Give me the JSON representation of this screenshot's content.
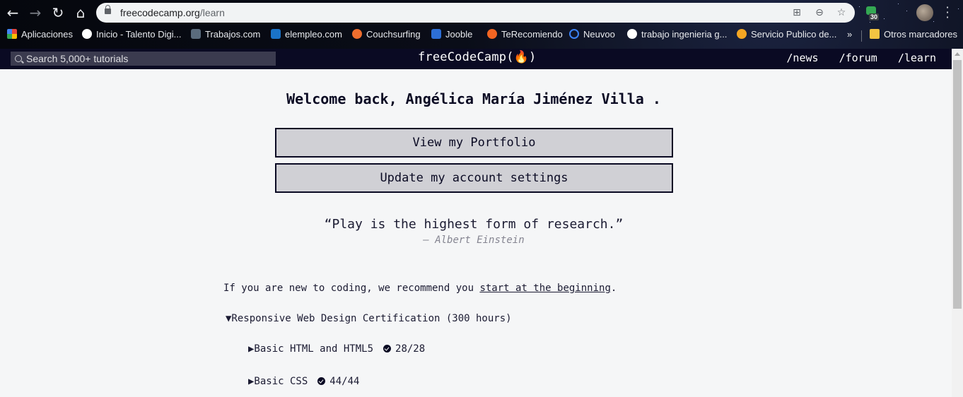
{
  "browser": {
    "url_host": "freecodecamp.org",
    "url_path": "/learn",
    "extension_badge": "30",
    "bookmarks": [
      {
        "label": "Aplicaciones",
        "color": "#e8453c"
      },
      {
        "label": "Inicio - Talento Digi...",
        "color": "#ffffff"
      },
      {
        "label": "Trabajos.com",
        "color": "#5a6b7d"
      },
      {
        "label": "elempleo.com",
        "color": "#1a73c8"
      },
      {
        "label": "Couchsurfing",
        "color": "#ee6e2e"
      },
      {
        "label": "Jooble",
        "color": "#2d6fd6"
      },
      {
        "label": "TeRecomiendo",
        "color": "#f26522"
      },
      {
        "label": "Neuvoo",
        "color": "#3b82f6"
      },
      {
        "label": "trabajo ingenieria g...",
        "color": "#ffffff"
      },
      {
        "label": "Servicio Publico de...",
        "color": "#f5a623"
      }
    ],
    "bookmarks_overflow": "»",
    "other_bookmarks": "Otros marcadores"
  },
  "navbar": {
    "search_placeholder": "Search 5,000+ tutorials",
    "brand": "freeCodeCamp(🔥)",
    "links": [
      "/news",
      "/forum",
      "/learn"
    ]
  },
  "main": {
    "welcome": "Welcome back, Angélica María Jiménez Villa .",
    "portfolio_button": "View my Portfolio",
    "settings_button": "Update my account settings",
    "quote": "“Play is the highest form of research.”",
    "author": "— Albert Einstein",
    "intro_text": "If you are new to coding, we recommend you ",
    "intro_link": "start at the beginning",
    "intro_end": ".",
    "certification": "▼Responsive Web Design Certification (300 hours)",
    "blocks": [
      {
        "label": "▶Basic HTML and HTML5",
        "progress": "28/28"
      },
      {
        "label": "▶Basic CSS",
        "progress": "44/44"
      }
    ]
  }
}
